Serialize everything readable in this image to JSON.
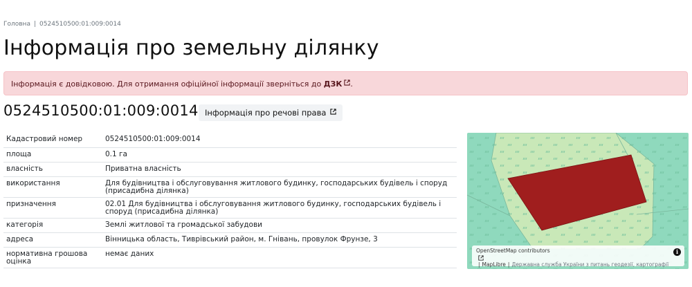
{
  "breadcrumb": {
    "home": "Головна",
    "current": "0524510500:01:009:0014"
  },
  "page_title": "Інформація про земельну ділянку",
  "alert": {
    "text": "Інформація є довідковою. Для отримання офіційної інформації зверніться до",
    "link": "ДЗК",
    "suffix": "."
  },
  "parcel": {
    "id": "0524510500:01:009:0014",
    "rights_button": "Інформація про речові права"
  },
  "details": [
    {
      "label": "Кадастровий номер",
      "value": "0524510500:01:009:0014"
    },
    {
      "label": "площа",
      "value": "0.1 га"
    },
    {
      "label": "власність",
      "value": "Приватна власність"
    },
    {
      "label": "використання",
      "value": "Для будівництва і обслуговування житлового будинку, господарських будівель і споруд (присадибна ділянка)"
    },
    {
      "label": "призначення",
      "value": "02.01 Для будівництва і обслуговування житлового будинку, господарських будівель і споруд (присадибна ділянка)"
    },
    {
      "label": "категорія",
      "value": "Землі житлової та громадської забудови"
    },
    {
      "label": "адреса",
      "value": "Вінницька область, Тиврівський район, м. Гнівань, провулок Фрунзе, 3"
    },
    {
      "label": "нормативна грошова оцінка",
      "value": "немає даних"
    }
  ],
  "map": {
    "attribution_osm": "OpenStreetMap contributors",
    "attribution_maplibre": "MapLibre",
    "attribution_gov": "Державна служба України з питань геодезії, картографії та кадастру",
    "colors": {
      "base": "#8fd9bd",
      "light": "#c9e8b8",
      "parcel": "#a01e1e",
      "outline": "#79b79c"
    }
  }
}
